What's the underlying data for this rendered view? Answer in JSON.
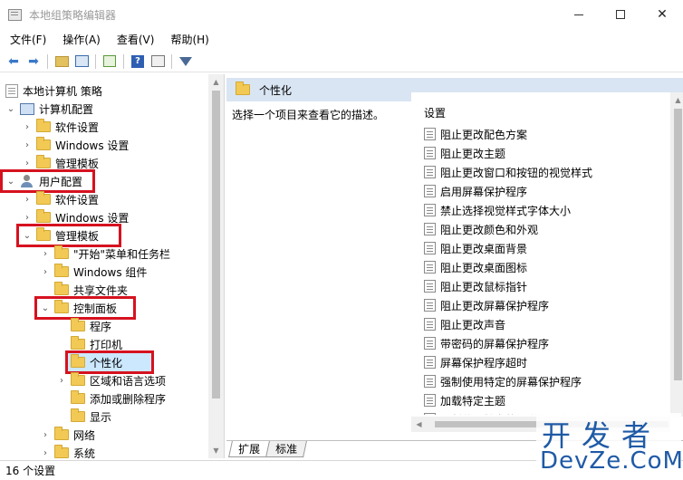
{
  "window": {
    "title": "本地组策略编辑器",
    "minimize": "—",
    "maximize": "☐",
    "close": "✕"
  },
  "menu": [
    "文件(F)",
    "操作(A)",
    "查看(V)",
    "帮助(H)"
  ],
  "toolbar": {
    "back": "back-arrow",
    "forward": "forward-arrow",
    "up": "folder-up",
    "show_hide": "console-tree",
    "export": "export-list",
    "help": "?",
    "properties": "properties",
    "filter": "filter"
  },
  "tree": {
    "root": "本地计算机 策略",
    "computer_config": "计算机配置",
    "cc_software": "软件设置",
    "cc_windows": "Windows 设置",
    "cc_admin": "管理模板",
    "user_config": "用户配置",
    "uc_software": "软件设置",
    "uc_windows": "Windows 设置",
    "uc_admin": "管理模板",
    "start_menu": "\"开始\"菜单和任务栏",
    "win_components": "Windows 组件",
    "shared_folders": "共享文件夹",
    "control_panel": "控制面板",
    "programs": "程序",
    "printers": "打印机",
    "personalization": "个性化",
    "regional": "区域和语言选项",
    "add_remove": "添加或删除程序",
    "display": "显示",
    "network": "网络",
    "system": "系统"
  },
  "right": {
    "header": "个性化",
    "description": "选择一个项目来查看它的描述。",
    "column_header": "设置",
    "settings": [
      "阻止更改配色方案",
      "阻止更改主题",
      "阻止更改窗口和按钮的视觉样式",
      "启用屏幕保护程序",
      "禁止选择视觉样式字体大小",
      "阻止更改颜色和外观",
      "阻止更改桌面背景",
      "阻止更改桌面图标",
      "阻止更改鼠标指针",
      "阻止更改屏幕保护程序",
      "阻止更改声音",
      "带密码的屏幕保护程序",
      "屏幕保护程序超时",
      "强制使用特定的屏幕保护程序",
      "加载特定主题",
      "强制使用特定的视觉样式文件或强制使用 Wind"
    ]
  },
  "tabs": [
    "扩展",
    "标准"
  ],
  "status": "16 个设置",
  "watermark": {
    "top": "开发者",
    "bottom": "DevZe.CoM"
  }
}
